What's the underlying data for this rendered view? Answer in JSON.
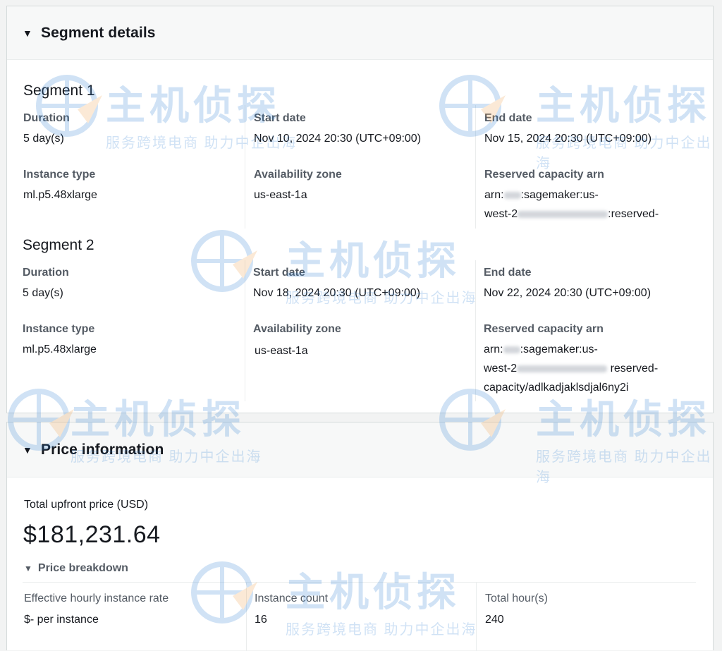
{
  "segment_details": {
    "title": "Segment details",
    "segments": [
      {
        "title": "Segment 1",
        "duration_label": "Duration",
        "duration": "5 day(s)",
        "start_label": "Start date",
        "start": "Nov 10, 2024 20:30 (UTC+09:00)",
        "end_label": "End date",
        "end": "Nov 15, 2024 20:30 (UTC+09:00)",
        "instance_label": "Instance type",
        "instance": "ml.p5.48xlarge",
        "az_label": "Availability zone",
        "az": "us-east-1a",
        "arn_label": "Reserved capacity arn",
        "arn_line1_a": "arn:",
        "arn_line1_b": ":sagemaker:us-",
        "arn_line2_a": "west-2",
        "arn_line2_b": ":reserved-"
      },
      {
        "title": "Segment 2",
        "duration_label": "Duration",
        "duration": "5 day(s)",
        "start_label": "Start date",
        "start": "Nov 18, 2024 20:30 (UTC+09:00)",
        "end_label": "End date",
        "end": "Nov 22, 2024 20:30 (UTC+09:00)",
        "instance_label": "Instance type",
        "instance": "ml.p5.48xlarge",
        "az_label": "Availability zone",
        "az": "us-east-1a",
        "arn_label": "Reserved capacity arn",
        "arn_line1_a": "arn:",
        "arn_line1_b": ":sagemaker:us-",
        "arn_line2_a": "west-2",
        "arn_line2_b": " reserved-",
        "arn_line3": "capacity/adlkadjaklsdjal6ny2i"
      }
    ]
  },
  "price_information": {
    "title": "Price information",
    "total_label": "Total upfront price (USD)",
    "total_value": "$181,231.64",
    "breakdown_label": "Price breakdown",
    "rate_label": "Effective hourly instance rate",
    "rate_value": "$- per instance",
    "count_label": "Instance count",
    "count_value": "16",
    "hours_label": "Total hour(s)",
    "hours_value": "240"
  },
  "watermark": {
    "brand": "主机侦探",
    "tagline": "服务跨境电商 助力中企出海",
    "color": "#2d7fd3"
  },
  "icons": {
    "expand": "caret-down-icon"
  }
}
